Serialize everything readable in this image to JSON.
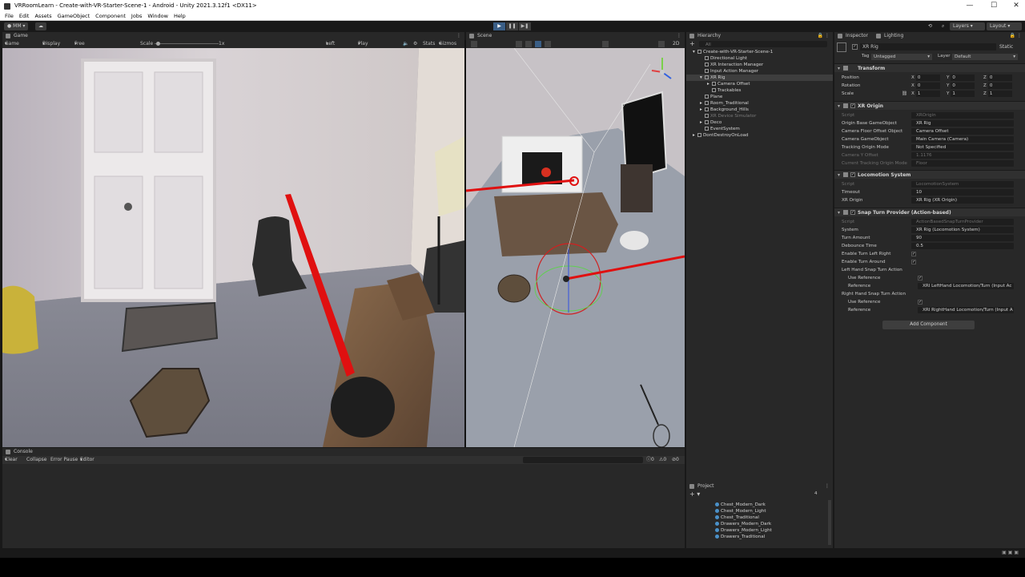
{
  "window": {
    "title": "VRRoomLearn - Create-with-VR-Starter-Scene-1 - Android - Unity 2021.3.12f1 <DX11>",
    "minimize": "—",
    "maximize": "☐",
    "close": "✕"
  },
  "menu": [
    "File",
    "Edit",
    "Assets",
    "GameObject",
    "Component",
    "Jobs",
    "Window",
    "Help"
  ],
  "toolbar": {
    "account": "MM",
    "layers": "Layers",
    "layout": "Layout"
  },
  "game": {
    "tab": "Game",
    "mode": "Game",
    "display": "Display 1",
    "aspect": "Free Aspect",
    "scale_label": "Scale",
    "scale_value": "1x",
    "eye": "Left Eye",
    "play_mode": "Play Focused",
    "stats": "Stats",
    "gizmos": "Gizmos"
  },
  "scene": {
    "tab": "Scene",
    "mode_2d": "2D"
  },
  "hierarchy": {
    "tab": "Hierarchy",
    "search_placeholder": "All",
    "items": [
      {
        "label": "Create-with-VR-Starter-Scene-1",
        "indent": 0,
        "arrow": "▾",
        "selected": false,
        "dim": false
      },
      {
        "label": "Directional Light",
        "indent": 1,
        "arrow": "",
        "selected": false,
        "dim": false
      },
      {
        "label": "XR Interaction Manager",
        "indent": 1,
        "arrow": "",
        "selected": false,
        "dim": false
      },
      {
        "label": "Input Action Manager",
        "indent": 1,
        "arrow": "",
        "selected": false,
        "dim": false
      },
      {
        "label": "XR Rig",
        "indent": 1,
        "arrow": "▾",
        "selected": true,
        "dim": false
      },
      {
        "label": "Camera Offset",
        "indent": 2,
        "arrow": "▸",
        "selected": false,
        "dim": false
      },
      {
        "label": "Trackables",
        "indent": 2,
        "arrow": "",
        "selected": false,
        "dim": false
      },
      {
        "label": "Plane",
        "indent": 1,
        "arrow": "",
        "selected": false,
        "dim": false
      },
      {
        "label": "Room_Traditional",
        "indent": 1,
        "arrow": "▸",
        "selected": false,
        "dim": false
      },
      {
        "label": "Background_Hills",
        "indent": 1,
        "arrow": "▸",
        "selected": false,
        "dim": false
      },
      {
        "label": "XR Device Simulator",
        "indent": 1,
        "arrow": "",
        "selected": false,
        "dim": true
      },
      {
        "label": "Deco",
        "indent": 1,
        "arrow": "▸",
        "selected": false,
        "dim": false
      },
      {
        "label": "EventSystem",
        "indent": 1,
        "arrow": "",
        "selected": false,
        "dim": false
      },
      {
        "label": "DontDestroyOnLoad",
        "indent": 0,
        "arrow": "▸",
        "selected": false,
        "dim": false
      }
    ]
  },
  "project": {
    "tab": "Project",
    "badge": "4",
    "items": [
      "Chest_Modern_Dark",
      "Chest_Modern_Light",
      "Chest_Traditional",
      "Drawers_Modern_Dark",
      "Drawers_Modern_Light",
      "Drawers_Traditional"
    ]
  },
  "inspector": {
    "tab": "Inspector",
    "lighting_tab": "Lighting",
    "object_name": "XR Rig",
    "static_label": "Static",
    "tag_label": "Tag",
    "tag_value": "Untagged",
    "layer_label": "Layer",
    "layer_value": "Default",
    "transform": {
      "header": "Transform",
      "position": "Position",
      "rotation": "Rotation",
      "scale": "Scale",
      "pos": [
        "0",
        "0",
        "0"
      ],
      "rot": [
        "0",
        "0",
        "0"
      ],
      "scl": [
        "1",
        "1",
        "1"
      ]
    },
    "xr_origin": {
      "header": "XR Origin",
      "rows": [
        {
          "label": "Script",
          "value": "XROrigin",
          "dim": true
        },
        {
          "label": "Origin Base GameObject",
          "value": "XR Rig",
          "dim": false
        },
        {
          "label": "Camera Floor Offset Object",
          "value": "Camera Offset",
          "dim": false
        },
        {
          "label": "Camera GameObject",
          "value": "Main Camera (Camera)",
          "dim": false
        },
        {
          "label": "Tracking Origin Mode",
          "value": "Not Specified",
          "dim": false
        },
        {
          "label": "Camera Y Offset",
          "value": "1.1176",
          "dim": true
        },
        {
          "label": "Current Tracking Origin Mode",
          "value": "Floor",
          "dim": true
        }
      ]
    },
    "locomotion": {
      "header": "Locomotion System",
      "rows": [
        {
          "label": "Script",
          "value": "LocomotionSystem",
          "dim": true
        },
        {
          "label": "Timeout",
          "value": "10",
          "dim": false
        },
        {
          "label": "XR Origin",
          "value": "XR Rig (XR Origin)",
          "dim": false
        }
      ]
    },
    "snap_turn": {
      "header": "Snap Turn Provider (Action-based)",
      "rows": [
        {
          "label": "Script",
          "value": "ActionBasedSnapTurnProvider",
          "dim": true
        },
        {
          "label": "System",
          "value": "XR Rig (Locomotion System)",
          "dim": false
        },
        {
          "label": "Turn Amount",
          "value": "90",
          "dim": false
        },
        {
          "label": "Debounce Time",
          "value": "0.5",
          "dim": false
        }
      ],
      "enable_left_right": "Enable Turn Left Right",
      "enable_around": "Enable Turn Around",
      "left_action": "Left Hand Snap Turn Action",
      "right_action": "Right Hand Snap Turn Action",
      "use_reference": "Use Reference",
      "reference": "Reference",
      "left_ref": "XRI LeftHand Locomotion/Turn (Input Ac",
      "right_ref": "XRI RightHand Locomotion/Turn (Input A"
    },
    "add_component": "Add Component"
  },
  "console": {
    "tab": "Console",
    "clear": "Clear",
    "collapse": "Collapse",
    "error_pause": "Error Pause",
    "editor": "Editor",
    "count_log": "0",
    "count_warn": "0",
    "count_err": "0"
  },
  "colors": {
    "accent_play": "#3a5e86",
    "panel_bg": "#282828",
    "laser_red": "#e01010"
  }
}
